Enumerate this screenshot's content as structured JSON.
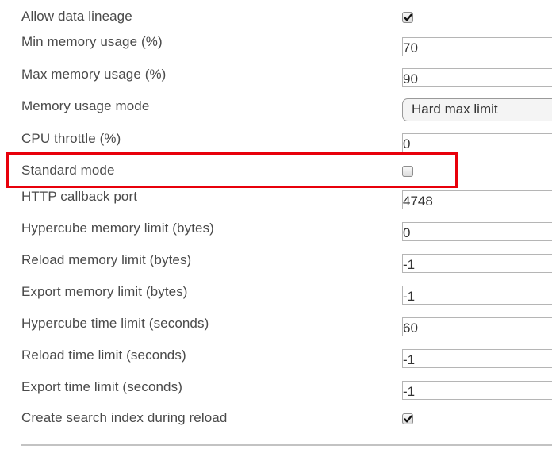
{
  "settings": [
    {
      "label": "Allow data lineage",
      "type": "checkbox",
      "checked": true
    },
    {
      "label": "Min memory usage (%)",
      "type": "input",
      "value": "70"
    },
    {
      "label": "Max memory usage (%)",
      "type": "input",
      "value": "90"
    },
    {
      "label": "Memory usage mode",
      "type": "select",
      "value": "Hard max limit"
    },
    {
      "label": "CPU throttle (%)",
      "type": "input",
      "value": "0"
    },
    {
      "label": "Standard mode",
      "type": "checkbox",
      "checked": false
    },
    {
      "label": "HTTP callback port",
      "type": "input",
      "value": "4748"
    },
    {
      "label": "Hypercube memory limit (bytes)",
      "type": "input",
      "value": "0"
    },
    {
      "label": "Reload memory limit (bytes)",
      "type": "input",
      "value": "-1"
    },
    {
      "label": "Export memory limit (bytes)",
      "type": "input",
      "value": "-1"
    },
    {
      "label": "Hypercube time limit (seconds)",
      "type": "input",
      "value": "60"
    },
    {
      "label": "Reload time limit (seconds)",
      "type": "input",
      "value": "-1"
    },
    {
      "label": "Export time limit (seconds)",
      "type": "input",
      "value": "-1"
    },
    {
      "label": "Create search index during reload",
      "type": "checkbox",
      "checked": true
    }
  ],
  "highlight": {
    "target": "Standard mode",
    "color": "#e8000b"
  }
}
